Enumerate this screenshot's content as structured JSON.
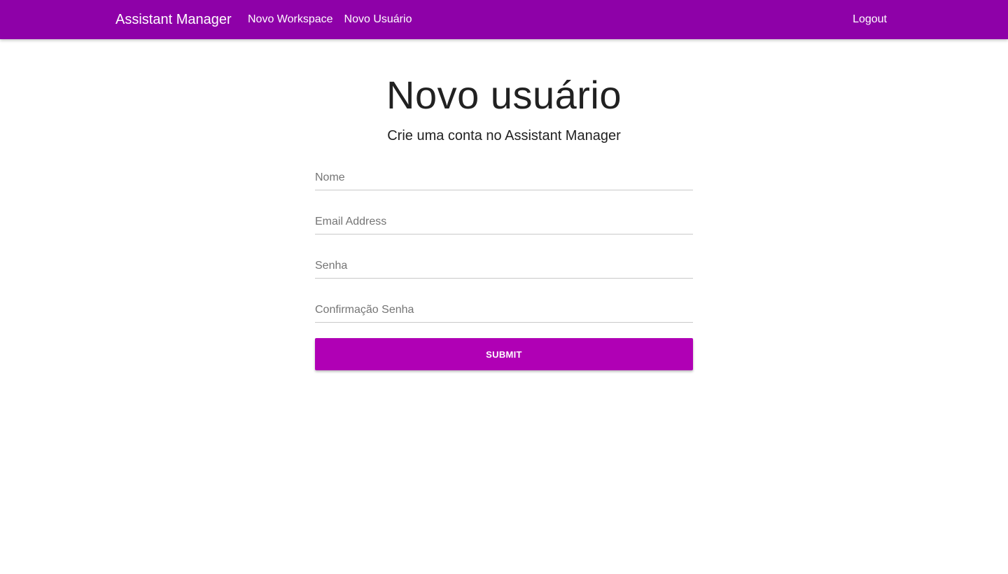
{
  "navbar": {
    "brand": "Assistant Manager",
    "links": [
      {
        "label": "Novo Workspace"
      },
      {
        "label": "Novo Usuário"
      }
    ],
    "logout_label": "Logout",
    "background": "#8e01a8"
  },
  "page": {
    "title": "Novo usuário",
    "subtitle": "Crie uma conta no Assistant Manager"
  },
  "form": {
    "fields": [
      {
        "placeholder": "Nome",
        "value": ""
      },
      {
        "placeholder": "Email Address",
        "value": ""
      },
      {
        "placeholder": "Senha",
        "value": ""
      },
      {
        "placeholder": "Confirmação Senha",
        "value": ""
      }
    ],
    "submit_label": "SUBMIT",
    "submit_color": "#b000b5"
  }
}
